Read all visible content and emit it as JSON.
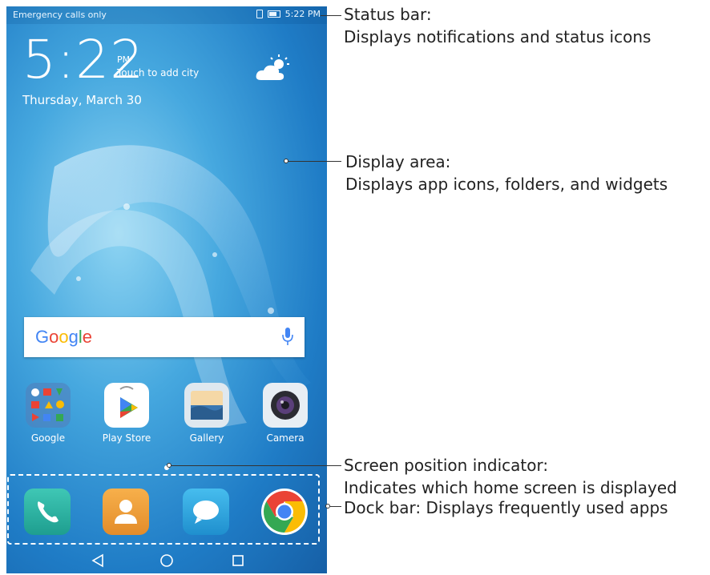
{
  "status_bar": {
    "carrier_text": "Emergency calls only",
    "time": "5:22 PM"
  },
  "lock_widget": {
    "clock": "5:22",
    "ampm": "PM",
    "city_hint": "Touch to add city",
    "date": "Thursday, March 30",
    "weather_icon": "partly-cloudy-icon"
  },
  "search_widget": {
    "logo": "Google",
    "mic_icon": "microphone-icon"
  },
  "apps": [
    {
      "label": "Google",
      "icon": "google-folder-icon"
    },
    {
      "label": "Play Store",
      "icon": "play-store-icon"
    },
    {
      "label": "Gallery",
      "icon": "gallery-icon"
    },
    {
      "label": "Camera",
      "icon": "camera-icon"
    }
  ],
  "dock": [
    {
      "icon": "phone-icon",
      "color": "#2bb5a6"
    },
    {
      "icon": "contacts-icon",
      "color": "#f0a23a"
    },
    {
      "icon": "messages-icon",
      "color": "#2fa6e0"
    },
    {
      "icon": "chrome-icon",
      "color": "#e94335"
    }
  ],
  "nav_bar": {
    "back_icon": "back-triangle-icon",
    "home_icon": "home-circle-icon",
    "recents_icon": "recents-square-icon"
  },
  "callouts": {
    "status_bar": {
      "title": "Status bar:",
      "text": "Displays notifications and status icons"
    },
    "display_area": {
      "title": "Display area:",
      "text": "Displays app icons, folders, and widgets"
    },
    "screen_indicator": {
      "title": "Screen position indicator:",
      "text": "Indicates which home screen is displayed"
    },
    "dock_bar": {
      "text": "Dock bar: Displays frequently used apps"
    }
  }
}
